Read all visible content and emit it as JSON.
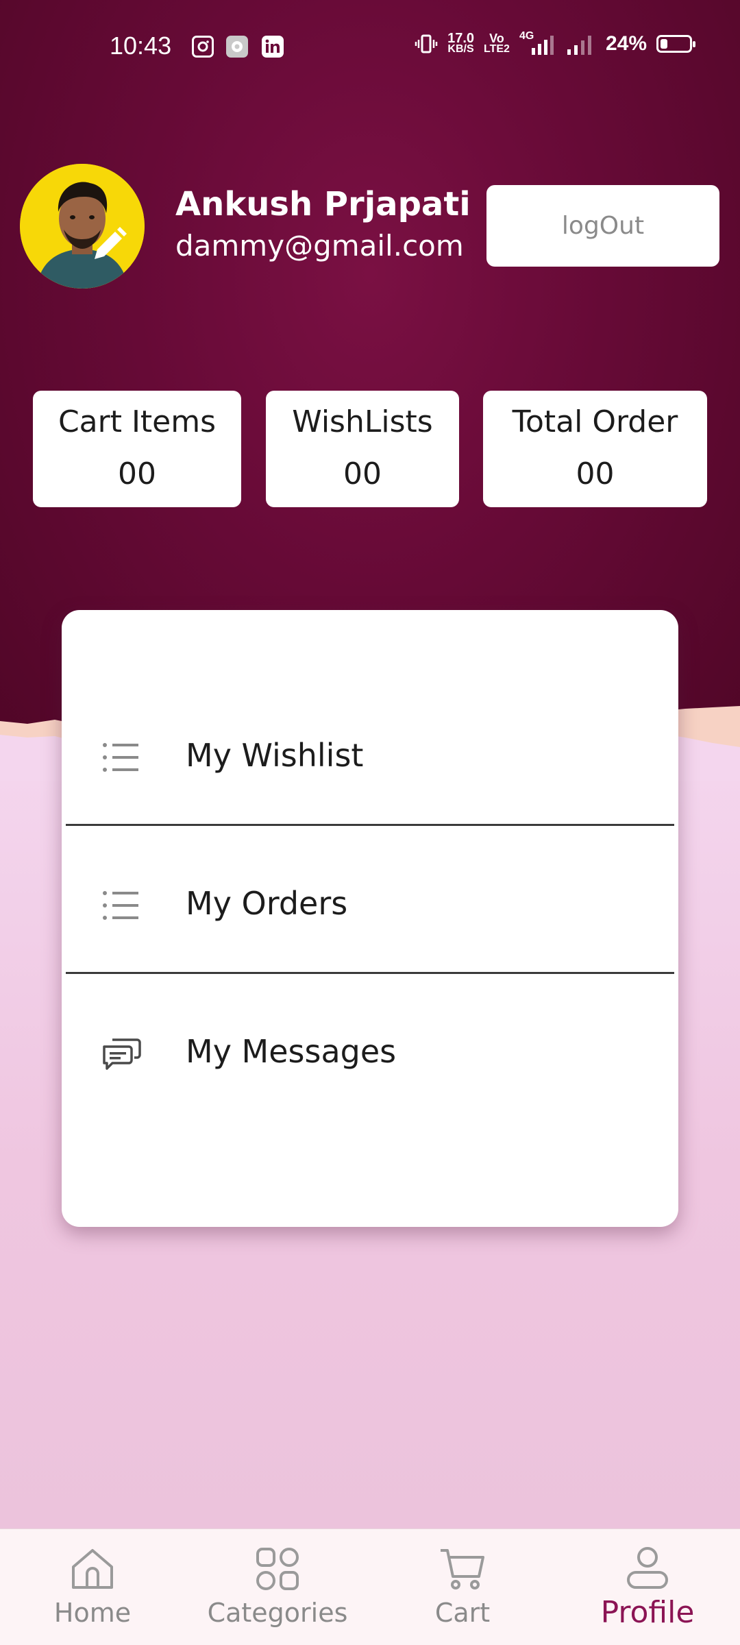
{
  "status_bar": {
    "time": "10:43",
    "net_speed_value": "17.0",
    "net_speed_unit": "KB/S",
    "volte_top": "Vo",
    "volte_bottom": "LTE2",
    "network_type": "4G",
    "battery_percent": "24%",
    "battery_level": 0.24,
    "app_icons": [
      "instagram-icon",
      "settings-icon",
      "linkedin-icon"
    ]
  },
  "profile": {
    "name": "Ankush Prjapati",
    "email": "dammy@gmail.com",
    "logout_label": "logOut"
  },
  "stats": [
    {
      "label": "Cart Items",
      "value": "00"
    },
    {
      "label": "WishLists",
      "value": "00"
    },
    {
      "label": "Total Order",
      "value": "00"
    }
  ],
  "menu": {
    "items": [
      {
        "label": "My Wishlist",
        "icon": "list-icon"
      },
      {
        "label": "My Orders",
        "icon": "list-icon"
      },
      {
        "label": "My Messages",
        "icon": "chat-icon"
      }
    ]
  },
  "bottom_nav": {
    "items": [
      {
        "label": "Home",
        "icon": "home-icon"
      },
      {
        "label": "Categories",
        "icon": "grid-icon"
      },
      {
        "label": "Cart",
        "icon": "cart-icon"
      },
      {
        "label": "Profile",
        "icon": "user-icon"
      }
    ],
    "active": "Profile"
  },
  "colors": {
    "hero_background": "#660a36",
    "page_background": "#f4d6ee",
    "active_nav": "#8b1454",
    "inactive_nav": "#8a8a8a"
  }
}
